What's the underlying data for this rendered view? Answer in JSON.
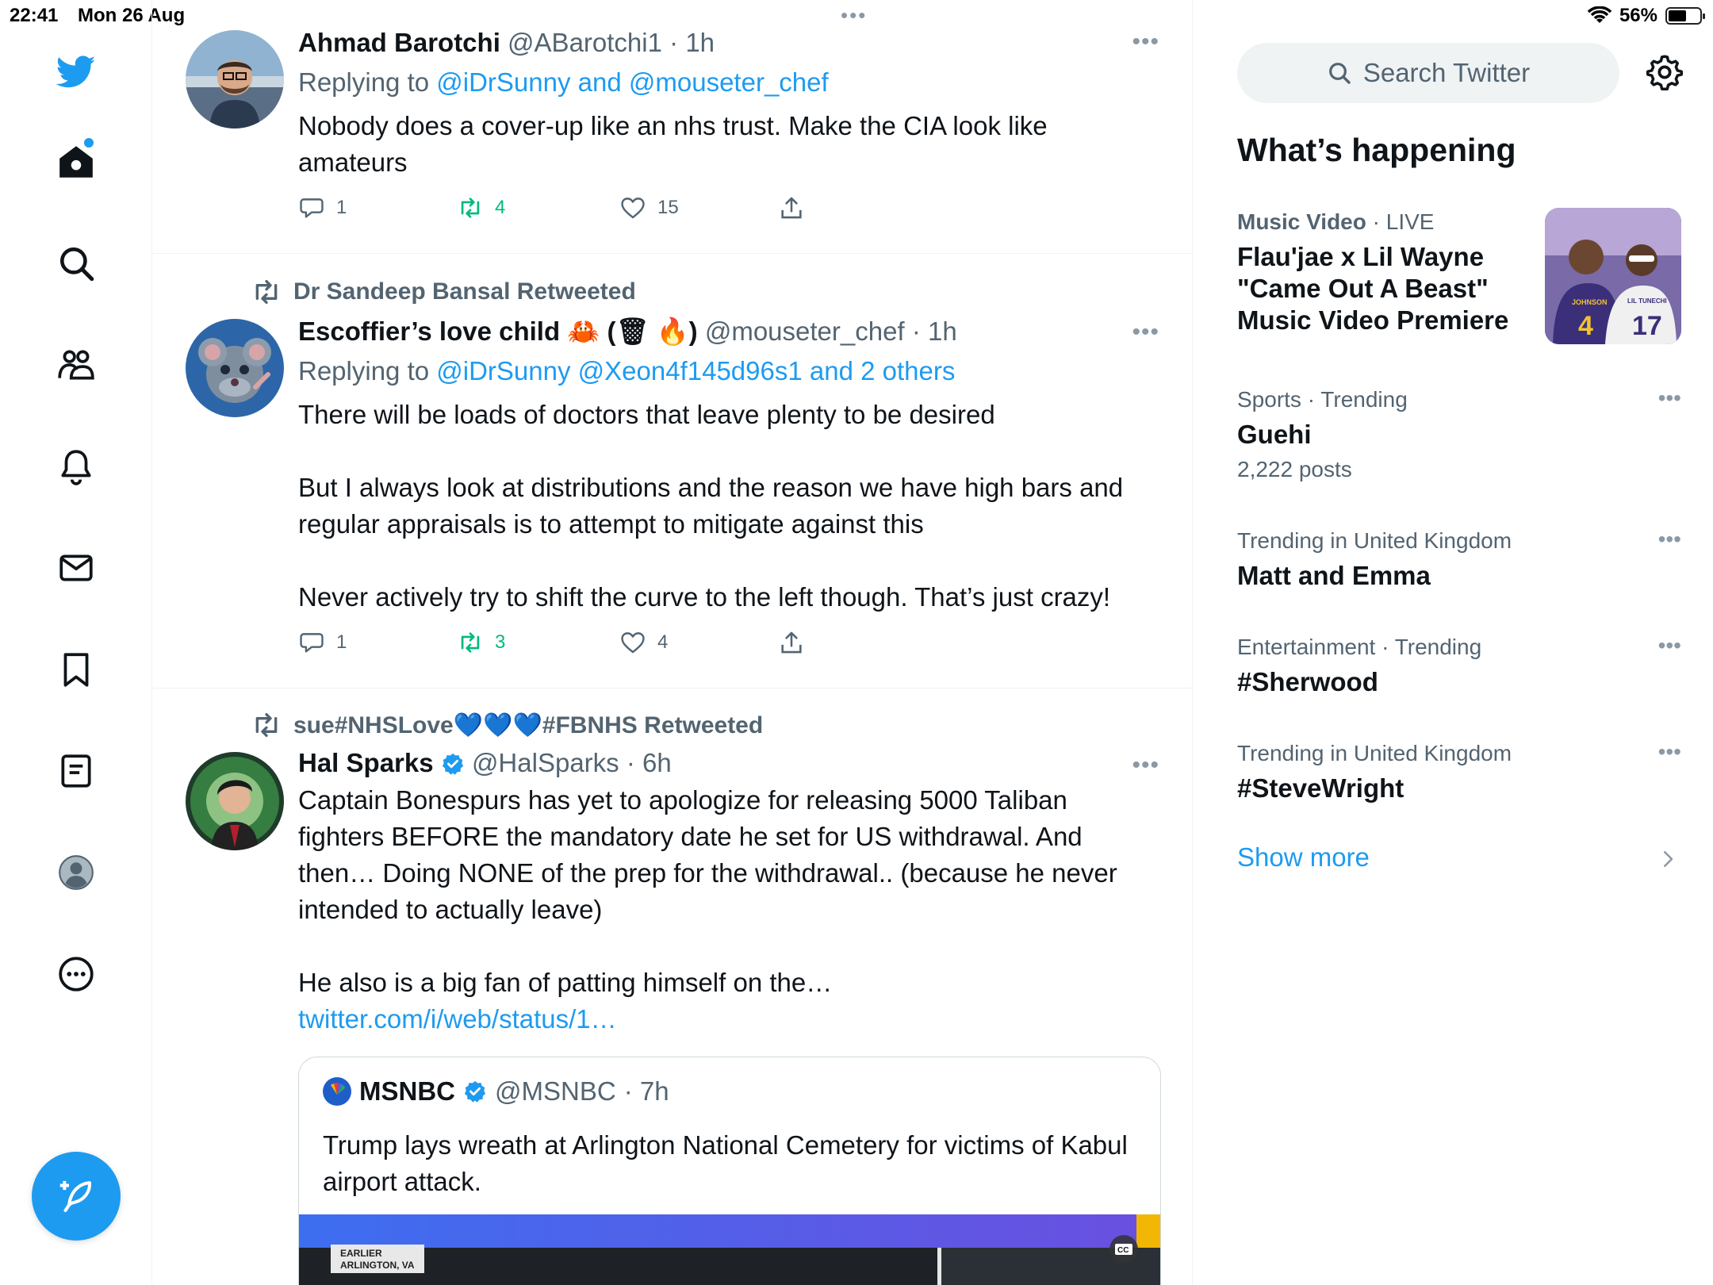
{
  "status_bar": {
    "time": "22:41",
    "date": "Mon 26 Aug",
    "battery": "56%",
    "battery_level": 0.56
  },
  "nav": {
    "items": [
      "twitter-logo",
      "home",
      "explore",
      "communities",
      "notifications",
      "messages",
      "bookmarks",
      "lists",
      "profile",
      "more"
    ],
    "accent": "#1d9bf0"
  },
  "tweets": [
    {
      "name": "Ahmad Barotchi",
      "handle": "@ABarotchi1",
      "time": "· 1h",
      "replying_prefix": "Replying to ",
      "replying_to": "@iDrSunny and @mouseter_chef",
      "text": [
        "Nobody does a cover-up like an nhs trust. Make the CIA look like amateurs"
      ],
      "replies": "1",
      "retweets": "4",
      "likes": "15"
    },
    {
      "retweeted_by": "Dr Sandeep Bansal Retweeted",
      "name": "Escoffier’s love child 🦀 (🗑 🔥)",
      "handle": "@mouseter_chef",
      "time": "· 1h",
      "replying_prefix": "Replying to ",
      "replying_to": "@iDrSunny @Xeon4f145d96s1 and 2 others",
      "text": [
        "There will be loads of doctors that leave plenty to be desired",
        "But I always look at distributions and the reason we have high bars and regular appraisals is to attempt to mitigate against this",
        "Never actively try to shift the curve to the left though. That’s just crazy!"
      ],
      "replies": "1",
      "retweets": "3",
      "likes": "4"
    },
    {
      "retweeted_by": "sue#NHSLove💙💙💙#FBNHS Retweeted",
      "name": "Hal Sparks",
      "handle": "@HalSparks",
      "time": "· 6h",
      "text": [
        "Captain Bonespurs has yet to apologize for releasing 5000 Taliban fighters BEFORE the mandatory date he set for US withdrawal. And then… Doing NONE of the prep for the withdrawal.. (because he never intended to actually leave)"
      ],
      "text2": "He also is a big fan of patting himself on the… ",
      "link": "twitter.com/i/web/status/1…",
      "quote": {
        "name": "MSNBC",
        "handle": "@MSNBC",
        "time": "· 7h",
        "text": "Trump lays wreath at Arlington National Cemetery for victims of Kabul airport attack.",
        "media_caption_1": "EARLIER",
        "media_caption_2": "ARLINGTON, VA",
        "media_badge": "CC"
      }
    }
  ],
  "sidebar": {
    "search_placeholder": "Search Twitter",
    "heading": "What’s happening",
    "trends": [
      {
        "category": "Music Video",
        "status": " · LIVE",
        "title": "Flau'jae x Lil Wayne \"Came Out A Beast\" Music Video Premiere",
        "image_caption_1": "JOHNSON",
        "image_num_1": "4",
        "image_caption_2": "LIL TUNECHI",
        "image_num_2": "17"
      },
      {
        "category": "Sports · Trending",
        "title": "Guehi",
        "posts": "2,222 posts"
      },
      {
        "category": "Trending in United Kingdom",
        "title": "Matt and Emma"
      },
      {
        "category": "Entertainment · Trending",
        "title": "#Sherwood"
      },
      {
        "category": "Trending in United Kingdom",
        "title": "#SteveWright"
      }
    ],
    "show_more": "Show more"
  },
  "colors": {
    "accent": "#1d9bf0",
    "retweet_green": "#00ba7c",
    "secondary_text": "#536471"
  }
}
